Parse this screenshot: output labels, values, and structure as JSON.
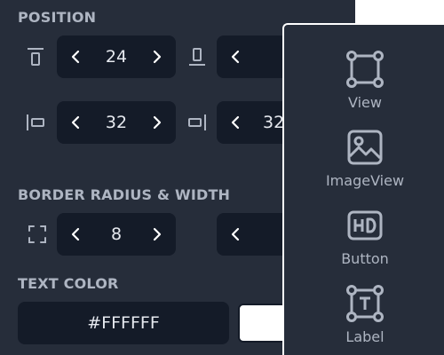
{
  "position": {
    "title": "POSITION",
    "top": {
      "icon": "align-top-icon",
      "value": "24"
    },
    "bottom": {
      "icon": "align-bottom-icon",
      "value": ""
    },
    "left": {
      "icon": "align-left-icon",
      "value": "32"
    },
    "right": {
      "icon": "align-right-icon",
      "value": "32"
    }
  },
  "border": {
    "title": "BORDER RADIUS & WIDTH",
    "radius": {
      "icon": "corner-radius-icon",
      "value": "8"
    },
    "width": {
      "value": ""
    }
  },
  "text_color": {
    "title": "TEXT COLOR",
    "hex": "#FFFFFF",
    "swatch": "#ffffff"
  },
  "components": [
    {
      "label": "View",
      "icon": "view-icon"
    },
    {
      "label": "ImageView",
      "icon": "image-icon"
    },
    {
      "label": "Button",
      "icon": "hd-button-icon"
    },
    {
      "label": "Label",
      "icon": "text-label-icon"
    }
  ],
  "colors": {
    "panel": "#262d3a",
    "field": "#141b28",
    "text": "#e6e9ef",
    "muted": "#aeb5c2"
  }
}
